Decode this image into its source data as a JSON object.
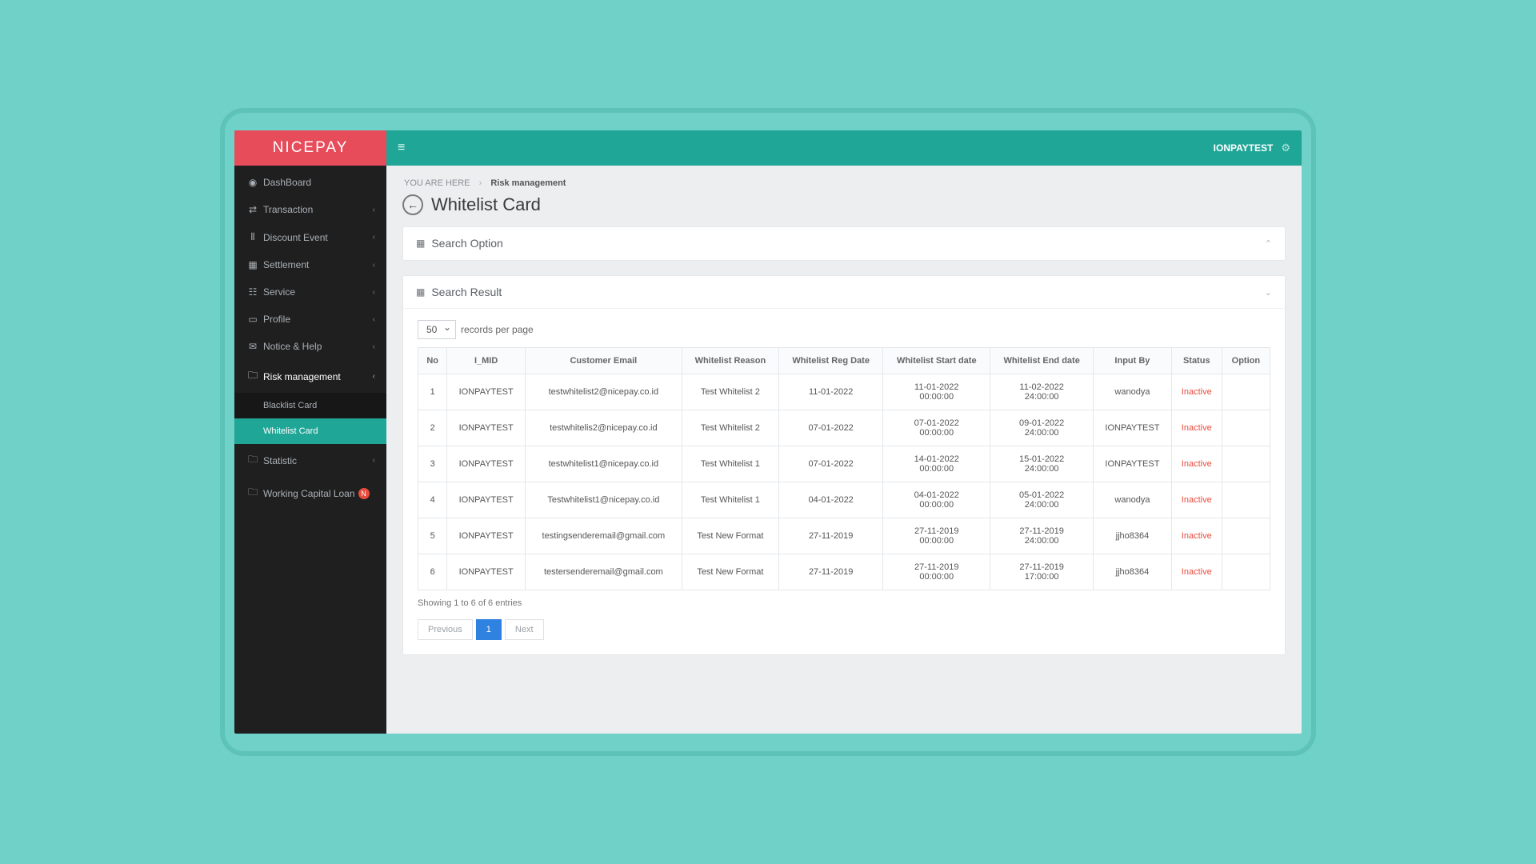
{
  "brand": "NICEPAY",
  "header": {
    "user": "IONPAYTEST"
  },
  "breadcrumb": {
    "label": "YOU ARE HERE",
    "current": "Risk management"
  },
  "page": {
    "title": "Whitelist Card"
  },
  "sidebar": {
    "items": [
      {
        "icon": "◉",
        "label": "DashBoard",
        "chev": false
      },
      {
        "icon": "⇄",
        "label": "Transaction",
        "chev": true
      },
      {
        "icon": "⫴",
        "label": "Discount Event",
        "chev": true
      },
      {
        "icon": "▦",
        "label": "Settlement",
        "chev": true
      },
      {
        "icon": "☷",
        "label": "Service",
        "chev": true
      },
      {
        "icon": "▭",
        "label": "Profile",
        "chev": true
      },
      {
        "icon": "✉",
        "label": "Notice & Help",
        "chev": true
      },
      {
        "icon": "🗀",
        "label": "Risk management",
        "chev": true
      },
      {
        "icon": "🗀",
        "label": "Statistic",
        "chev": true
      },
      {
        "icon": "🗀",
        "label": "Working Capital Loan",
        "chev": false,
        "badge": "N"
      }
    ],
    "sub_risk": [
      {
        "label": "Blacklist Card"
      },
      {
        "label": "Whitelist Card"
      }
    ]
  },
  "panels": {
    "search_option": "Search Option",
    "search_result": "Search Result"
  },
  "table": {
    "per_page_value": "50",
    "per_page_label": "records per page",
    "columns": [
      "No",
      "I_MID",
      "Customer Email",
      "Whitelist Reason",
      "Whitelist Reg Date",
      "Whitelist Start date",
      "Whitelist End date",
      "Input By",
      "Status",
      "Option"
    ],
    "rows": [
      {
        "no": "1",
        "mid": "IONPAYTEST",
        "email": "testwhitelist2@nicepay.co.id",
        "reason": "Test Whitelist 2",
        "reg": "11-01-2022",
        "start": "11-01-2022 00:00:00",
        "end": "11-02-2022 24:00:00",
        "input": "wanodya",
        "status": "Inactive"
      },
      {
        "no": "2",
        "mid": "IONPAYTEST",
        "email": "testwhitelis2@nicepay.co.id",
        "reason": "Test Whitelist 2",
        "reg": "07-01-2022",
        "start": "07-01-2022 00:00:00",
        "end": "09-01-2022 24:00:00",
        "input": "IONPAYTEST",
        "status": "Inactive"
      },
      {
        "no": "3",
        "mid": "IONPAYTEST",
        "email": "testwhitelist1@nicepay.co.id",
        "reason": "Test Whitelist 1",
        "reg": "07-01-2022",
        "start": "14-01-2022 00:00:00",
        "end": "15-01-2022 24:00:00",
        "input": "IONPAYTEST",
        "status": "Inactive"
      },
      {
        "no": "4",
        "mid": "IONPAYTEST",
        "email": "Testwhitelist1@nicepay.co.id",
        "reason": "Test Whitelist 1",
        "reg": "04-01-2022",
        "start": "04-01-2022 00:00:00",
        "end": "05-01-2022 24:00:00",
        "input": "wanodya",
        "status": "Inactive"
      },
      {
        "no": "5",
        "mid": "IONPAYTEST",
        "email": "testingsenderemail@gmail.com",
        "reason": "Test New Format",
        "reg": "27-11-2019",
        "start": "27-11-2019 00:00:00",
        "end": "27-11-2019 24:00:00",
        "input": "jjho8364",
        "status": "Inactive"
      },
      {
        "no": "6",
        "mid": "IONPAYTEST",
        "email": "testersenderemail@gmail.com",
        "reason": "Test New Format",
        "reg": "27-11-2019",
        "start": "27-11-2019 00:00:00",
        "end": "27-11-2019 17:00:00",
        "input": "jjho8364",
        "status": "Inactive"
      }
    ],
    "summary": "Showing 1 to 6 of 6 entries"
  },
  "pager": {
    "prev": "Previous",
    "pages": [
      "1"
    ],
    "next": "Next"
  }
}
